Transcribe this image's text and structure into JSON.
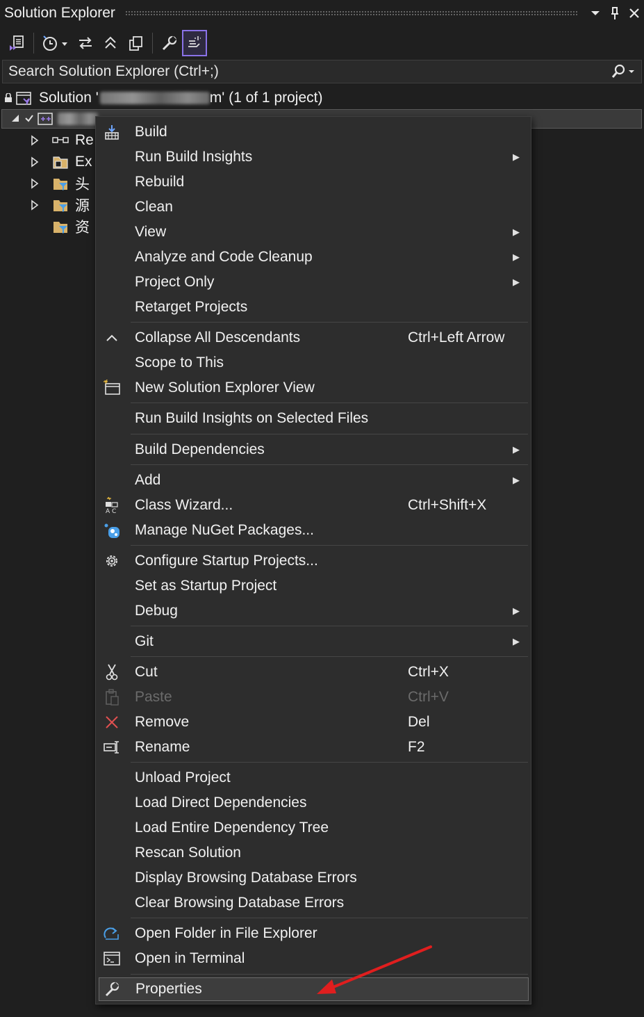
{
  "window": {
    "title": "Solution Explorer",
    "dropdown_icon": "chevron-down-icon",
    "pin_icon": "pin-icon",
    "close_icon": "close-icon"
  },
  "toolbar": {
    "buttons": [
      "switch-views-icon",
      "pending-changes-filter-icon",
      "sync-with-active-document-icon",
      "collapse-all-icon",
      "show-all-files-icon",
      "properties-icon",
      "preview-selected-items-icon"
    ]
  },
  "search": {
    "placeholder": "Search Solution Explorer (Ctrl+;)"
  },
  "tree": {
    "solution_prefix": "Solution '",
    "solution_suffix": "m' (1 of 1 project)",
    "children": [
      {
        "label": "Re"
      },
      {
        "label": "Ex"
      },
      {
        "label": "头"
      },
      {
        "label": "源"
      },
      {
        "label": "资"
      }
    ]
  },
  "context_menu": {
    "items": {
      "build": "Build",
      "run_build_insights": "Run Build Insights",
      "rebuild": "Rebuild",
      "clean": "Clean",
      "view": "View",
      "analyze": "Analyze and Code Cleanup",
      "project_only": "Project Only",
      "retarget": "Retarget Projects",
      "collapse_all": "Collapse All Descendants",
      "collapse_all_sc": "Ctrl+Left Arrow",
      "scope_to_this": "Scope to This",
      "new_view": "New Solution Explorer View",
      "run_build_insights_selected": "Run Build Insights on Selected Files",
      "build_dependencies": "Build Dependencies",
      "add": "Add",
      "class_wizard": "Class Wizard...",
      "class_wizard_sc": "Ctrl+Shift+X",
      "manage_nuget": "Manage NuGet Packages...",
      "configure_startup": "Configure Startup Projects...",
      "set_startup": "Set as Startup Project",
      "debug": "Debug",
      "git": "Git",
      "cut": "Cut",
      "cut_sc": "Ctrl+X",
      "paste": "Paste",
      "paste_sc": "Ctrl+V",
      "remove": "Remove",
      "remove_sc": "Del",
      "rename": "Rename",
      "rename_sc": "F2",
      "unload": "Unload Project",
      "load_direct": "Load Direct Dependencies",
      "load_entire": "Load Entire Dependency Tree",
      "rescan": "Rescan Solution",
      "display_db_errors": "Display Browsing Database Errors",
      "clear_db_errors": "Clear Browsing Database Errors",
      "open_folder": "Open Folder in File Explorer",
      "open_terminal": "Open in Terminal",
      "properties": "Properties"
    }
  },
  "colors": {
    "background": "#1f1f1f",
    "menu_background": "#2d2d2d",
    "accent": "#8a72e8",
    "annotation_arrow": "#e01e1e",
    "remove_icon": "#e05050"
  }
}
